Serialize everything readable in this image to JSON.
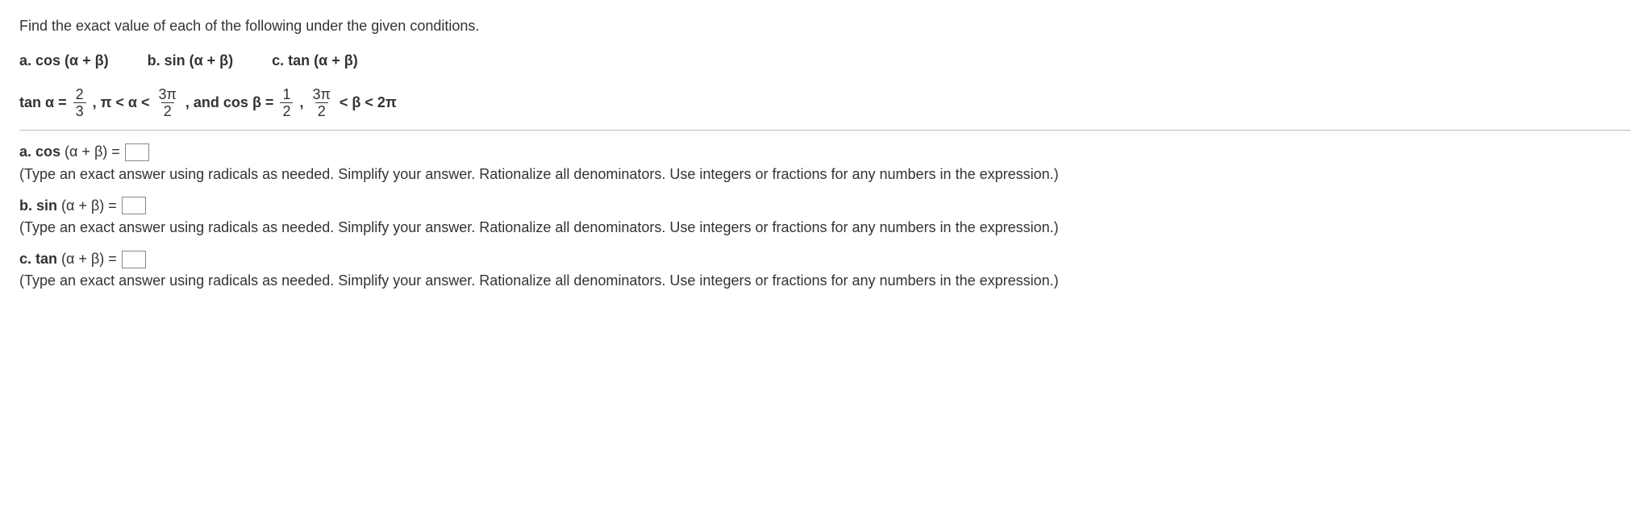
{
  "problem_statement": "Find the exact value of each of the following under the given conditions.",
  "parts": {
    "a_label": "a. cos (α + β)",
    "b_label": "b. sin (α + β)",
    "c_label": "c. tan (α + β)"
  },
  "given": {
    "tan_alpha_eq": "tan α =",
    "frac1_num": "2",
    "frac1_den": "3",
    "comma1": ", π < α <",
    "frac2_num": "3π",
    "frac2_den": "2",
    "and_cos_beta": ", and cos β =",
    "frac3_num": "1",
    "frac3_den": "2",
    "comma2": ",",
    "frac4_num": "3π",
    "frac4_den": "2",
    "beta_range_end": "< β < 2π"
  },
  "answers": {
    "a": {
      "prefix_bold": "a. cos ",
      "expr": "(α + β) =",
      "instruction": "(Type an exact answer using radicals as needed. Simplify your answer. Rationalize all denominators. Use integers or fractions for any numbers in the expression.)"
    },
    "b": {
      "prefix_bold": "b. sin ",
      "expr": "(α + β) =",
      "instruction": "(Type an exact answer using radicals as needed. Simplify your answer. Rationalize all denominators. Use integers or fractions for any numbers in the expression.)"
    },
    "c": {
      "prefix_bold": "c. tan ",
      "expr": "(α + β) =",
      "instruction": "(Type an exact answer using radicals as needed. Simplify your answer. Rationalize all denominators. Use integers or fractions for any numbers in the expression.)"
    }
  }
}
